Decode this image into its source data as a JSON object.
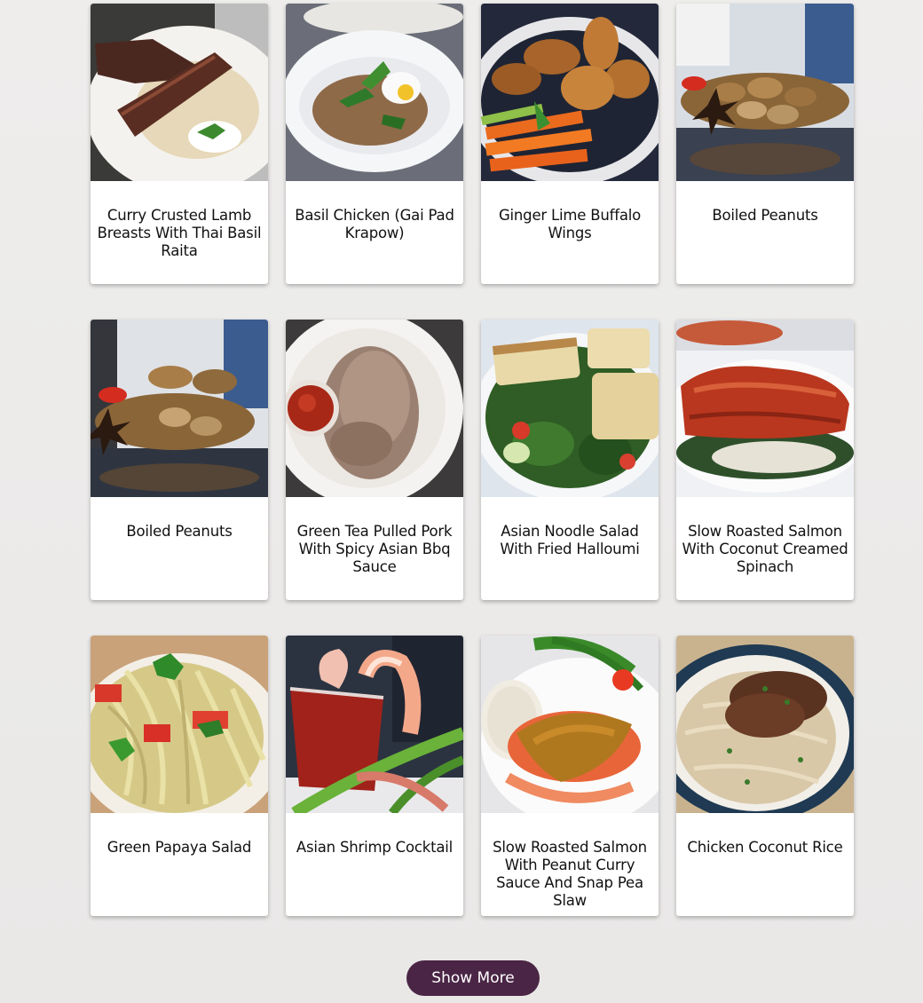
{
  "recipes": [
    {
      "title": "Curry Crusted Lamb Breasts With Thai Basil Raita",
      "image": "lamb-curry-photo"
    },
    {
      "title": "Basil Chicken (Gai Pad Krapow)",
      "image": "basil-chicken-photo"
    },
    {
      "title": "Ginger Lime Buffalo Wings",
      "image": "buffalo-wings-photo"
    },
    {
      "title": "Boiled Peanuts",
      "image": "boiled-peanuts-photo"
    },
    {
      "title": "Boiled Peanuts",
      "image": "boiled-peanuts-photo"
    },
    {
      "title": "Green Tea Pulled Pork With Spicy Asian Bbq Sauce",
      "image": "pulled-pork-photo"
    },
    {
      "title": "Asian Noodle Salad With Fried Halloumi",
      "image": "halloumi-salad-photo"
    },
    {
      "title": "Slow Roasted Salmon With Coconut Creamed Spinach",
      "image": "salmon-spinach-photo"
    },
    {
      "title": "Green Papaya Salad",
      "image": "papaya-salad-photo"
    },
    {
      "title": "Asian Shrimp Cocktail",
      "image": "shrimp-cocktail-photo"
    },
    {
      "title": "Slow Roasted Salmon With Peanut Curry Sauce And Snap Pea Slaw",
      "image": "salmon-curry-photo"
    },
    {
      "title": "Chicken Coconut Rice",
      "image": "coconut-rice-photo"
    }
  ],
  "show_more": {
    "label": "Show More",
    "color": "#4a2545"
  }
}
